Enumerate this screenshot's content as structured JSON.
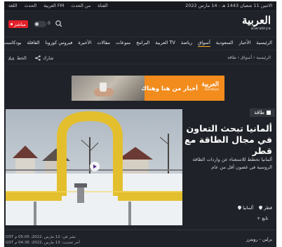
{
  "topbar": {
    "date": "الاثنين 11 شعبان 1443 هـ - 14 مارس 2022",
    "links": [
      "القناة",
      "من الحدث",
      "العربية FM",
      "الحدث",
      "اللغة"
    ]
  },
  "header": {
    "live_label": "مباشر",
    "toggle_label": "0",
    "logo_arabic": "العربية",
    "logo_latin": "alarabiya"
  },
  "nav": {
    "items": [
      "الرئيسية",
      "الأخبار",
      "السعودية",
      "أسواق",
      "رياضة",
      "العربية TV",
      "البرامج",
      "منوعات",
      "مقالات",
      "الأخيرة",
      "فيروس كورونا",
      "القافلة",
      "بودكاست"
    ],
    "active_index": 3
  },
  "sharebar": {
    "breadcrumb": "الرئيسية › أسواق › طاقة",
    "share_label": "شارك",
    "font_label": "الخط"
  },
  "ad": {
    "tagline": "أخبار من هنا وهناك",
    "brand": "العربية",
    "brand_latin": "alarabiya"
  },
  "article": {
    "category": "طاقة",
    "headline": "ألمانيا تبحث التعاون في مجال الطاقة مع قطر",
    "summary": "ألمانيا تخطط للاستغناء عن واردات الطاقة الروسية في غضون أقل من عام",
    "tags": [
      "قطر",
      "ألمانيا"
    ],
    "follow_label": "تابع",
    "author": "برلين - رويترز",
    "published": "نشر في: 12 مارس ,2022: 05:05 م GST",
    "updated": "آخر تحديث: 13 مارس ,2022: 04:36 م GST"
  },
  "colors": {
    "background": "#1f2228",
    "accent": "#f9a825",
    "live": "#e4202a",
    "ad_orange": "#f28c1d"
  },
  "icons": [
    "search-icon",
    "share-icon",
    "font-size-icon",
    "tag-icon",
    "location-icon",
    "play-icon",
    "plus-icon"
  ]
}
